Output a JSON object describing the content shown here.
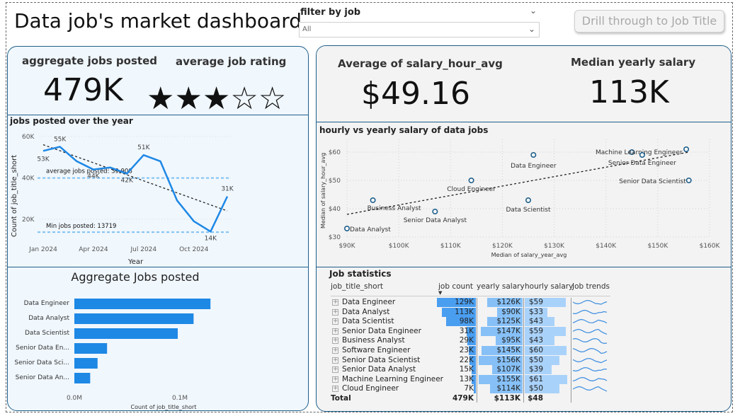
{
  "header": {
    "title": "Data job's market dashboard",
    "filter_label": "filter by job",
    "filter_value": "All",
    "drill_button": "Drill through to Job Title"
  },
  "kpis": {
    "agg_jobs_title": "aggregate jobs posted",
    "agg_jobs_value": "479K",
    "rating_title": "average job rating",
    "rating_value": 3,
    "rating_max": 5,
    "salary_hour_title": "Average of salary_hour_avg",
    "salary_hour_value": "$49.16",
    "median_year_title": "Median yearly salary",
    "median_year_value": "113K"
  },
  "line_chart": {
    "title": "jobs posted over the year",
    "ylabel": "Count of job_title_short",
    "xlabel": "Year",
    "y_ticks": [
      "60K",
      "40K",
      "20K"
    ],
    "x_ticks": [
      "Jan 2024",
      "Apr 2024",
      "Jul 2024",
      "Oct 2024"
    ],
    "avg_label": "average jobs posted: 39,908",
    "min_label": "Min jobs posted: 13719",
    "chart_data": {
      "type": "line",
      "x": [
        "Jan 2024",
        "Feb 2024",
        "Mar 2024",
        "Apr 2024",
        "May 2024",
        "Jun 2024",
        "Jul 2024",
        "Aug 2024",
        "Sep 2024",
        "Oct 2024",
        "Nov 2024",
        "Dec 2024"
      ],
      "values": [
        53000,
        55000,
        48000,
        44000,
        45000,
        42000,
        51000,
        48000,
        29000,
        19000,
        14000,
        31000
      ],
      "point_labels": [
        "53K",
        "55K",
        "",
        "44K",
        "",
        "42K",
        "51K",
        "",
        "",
        "",
        "14K",
        "31K"
      ],
      "ylim": [
        10000,
        62000
      ],
      "average": 39908,
      "min": 13719,
      "trend_start": 56000,
      "trend_end": 24000
    }
  },
  "bar_chart": {
    "title": "Aggregate Jobs posted",
    "xlabel": "Count of job_title_short",
    "x_ticks": [
      "0.0M",
      "0.1M"
    ],
    "chart_data": {
      "type": "bar",
      "categories": [
        "Data Engineer",
        "Data Analyst",
        "Data Scientist",
        "Senior Data En...",
        "Senior Data Sci...",
        "Senior Data An..."
      ],
      "values": [
        129000,
        113000,
        98000,
        31000,
        22000,
        15000
      ],
      "xlim": [
        0,
        200000
      ]
    }
  },
  "scatter_chart": {
    "title": "hourly vs yearly salary of data jobs",
    "xlabel": "Median of salary_year_avg",
    "ylabel": "Median of salary_hour_avg",
    "x_ticks": [
      "$90K",
      "$100K",
      "$110K",
      "$120K",
      "$130K",
      "$140K",
      "$150K",
      "$160K"
    ],
    "y_ticks": [
      "$60",
      "$50",
      "$40",
      "$30"
    ],
    "chart_data": {
      "type": "scatter",
      "xlim": [
        90000,
        160000
      ],
      "ylim": [
        30,
        63
      ],
      "points": [
        {
          "label": "Data Analyst",
          "x": 90000,
          "y": 33
        },
        {
          "label": "Business Analyst",
          "x": 95000,
          "y": 43
        },
        {
          "label": "Senior Data Analyst",
          "x": 107000,
          "y": 39
        },
        {
          "label": "Cloud Engineer",
          "x": 114000,
          "y": 50
        },
        {
          "label": "Data Engineer",
          "x": 126000,
          "y": 59
        },
        {
          "label": "Data Scientist",
          "x": 125000,
          "y": 43
        },
        {
          "label": "Machine Learning Engineer",
          "x": 145000,
          "y": 60
        },
        {
          "label": "Senior Data Engineer",
          "x": 147000,
          "y": 59
        },
        {
          "label": "Senior Data Scientist",
          "x": 156000,
          "y": 50
        },
        {
          "label": "",
          "x": 155500,
          "y": 61
        }
      ],
      "trend_start": 38,
      "trend_end": 60
    }
  },
  "table": {
    "title": "Job statistics",
    "headers": [
      "job_title_short",
      "job count",
      "yearly salary",
      "hourly salary",
      "Job trends"
    ],
    "rows": [
      {
        "name": "Data Engineer",
        "count": "129K",
        "count_v": 129,
        "yearly": "$126K",
        "yearly_v": 126,
        "hourly": "$59",
        "hourly_v": 59
      },
      {
        "name": "Data Analyst",
        "count": "113K",
        "count_v": 113,
        "yearly": "$90K",
        "yearly_v": 90,
        "hourly": "$33",
        "hourly_v": 33
      },
      {
        "name": "Data Scientist",
        "count": "98K",
        "count_v": 98,
        "yearly": "$125K",
        "yearly_v": 125,
        "hourly": "$43",
        "hourly_v": 43
      },
      {
        "name": "Senior Data Engineer",
        "count": "31K",
        "count_v": 31,
        "yearly": "$147K",
        "yearly_v": 147,
        "hourly": "$59",
        "hourly_v": 59
      },
      {
        "name": "Business Analyst",
        "count": "29K",
        "count_v": 29,
        "yearly": "$95K",
        "yearly_v": 95,
        "hourly": "$43",
        "hourly_v": 43
      },
      {
        "name": "Software Engineer",
        "count": "23K",
        "count_v": 23,
        "yearly": "$145K",
        "yearly_v": 145,
        "hourly": "$60",
        "hourly_v": 60
      },
      {
        "name": "Senior Data Scientist",
        "count": "22K",
        "count_v": 22,
        "yearly": "$156K",
        "yearly_v": 156,
        "hourly": "$50",
        "hourly_v": 50
      },
      {
        "name": "Senior Data Analyst",
        "count": "15K",
        "count_v": 15,
        "yearly": "$107K",
        "yearly_v": 107,
        "hourly": "$39",
        "hourly_v": 39
      },
      {
        "name": "Machine Learning Engineer",
        "count": "13K",
        "count_v": 13,
        "yearly": "$155K",
        "yearly_v": 155,
        "hourly": "$61",
        "hourly_v": 61
      },
      {
        "name": "Cloud Engineer",
        "count": "7K",
        "count_v": 7,
        "yearly": "$114K",
        "yearly_v": 114,
        "hourly": "$50",
        "hourly_v": 50
      }
    ],
    "total": {
      "name": "Total",
      "count": "479K",
      "yearly": "$113K",
      "hourly": "$48"
    }
  },
  "colors": {
    "line": "#1e88e5",
    "bar": "#1e88e5",
    "accent": "#1f5f8b",
    "count_bar": "#4a9ef0",
    "yearly_bar": "#86c0f7",
    "hourly_bar": "#a9d2fa"
  }
}
